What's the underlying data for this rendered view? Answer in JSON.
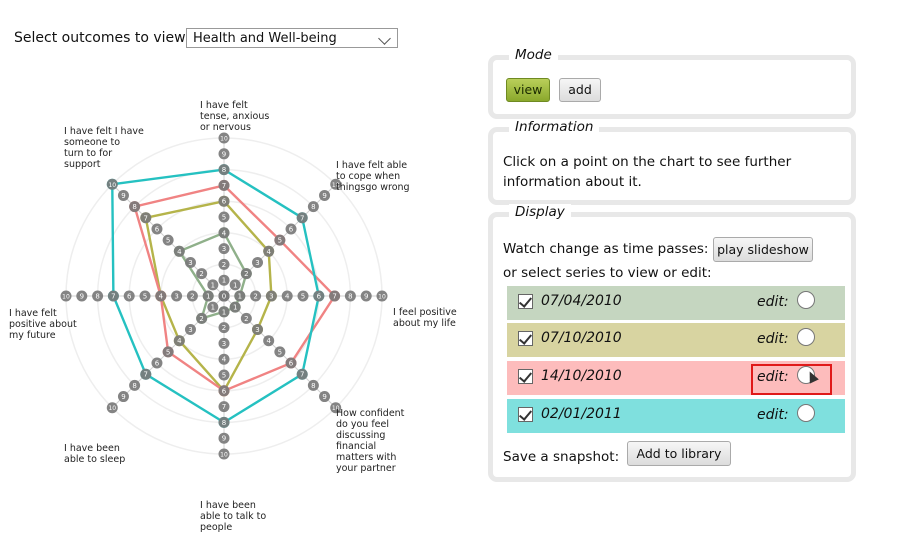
{
  "outcome_select": {
    "label": "Select outcomes to view:",
    "value": "Health and Well-being"
  },
  "chart_data": {
    "type": "radar",
    "axes": [
      "I have felt tense, anxious or nervous",
      "I have felt able to cope when things go wrong",
      "I feel positive about my life",
      "How confident do you feel discussing financial matters with your partner",
      "I have been able to talk to people",
      "I have been able to sleep",
      "I have felt positive about my future",
      "I have felt I have someone to turn to for support"
    ],
    "axis_label_lines": [
      [
        "I have felt",
        "tense, anxious",
        "or nervous"
      ],
      [
        "I have felt able",
        "to cope when",
        "thingsgo wrong"
      ],
      [
        "I feel positive",
        "about my life"
      ],
      [
        "How confident",
        "do you feel",
        "discussing",
        "financial",
        "matters with",
        "your partner"
      ],
      [
        "I have been",
        "able to talk to",
        "people"
      ],
      [
        "I have been",
        "able to sleep"
      ],
      [
        "I have felt",
        "positive about",
        "my future"
      ],
      [
        "I have felt I have",
        "someone to",
        "turn to for",
        "support"
      ]
    ],
    "scale": [
      0,
      10
    ],
    "ticks": [
      0,
      1,
      2,
      3,
      4,
      5,
      6,
      7,
      8,
      9,
      10
    ],
    "series": [
      {
        "name": "07/04/2010",
        "color": "#8fb08a",
        "values": [
          4,
          2,
          1,
          1,
          1,
          2,
          1,
          4
        ]
      },
      {
        "name": "07/10/2010",
        "color": "#b5b44a",
        "values": [
          6,
          4,
          3,
          3,
          6,
          4,
          4,
          7
        ]
      },
      {
        "name": "14/10/2010",
        "color": "#f08383",
        "values": [
          7,
          5,
          7,
          6,
          6,
          5,
          4,
          8
        ]
      },
      {
        "name": "02/01/2011",
        "color": "#25c1c1",
        "values": [
          8,
          7,
          6,
          7,
          8,
          7,
          7,
          10
        ]
      }
    ]
  },
  "mode": {
    "legend": "Mode",
    "view_label": "view",
    "add_label": "add"
  },
  "information": {
    "legend": "Information",
    "text": "Click on a point on the chart to see further information about it."
  },
  "display": {
    "legend": "Display",
    "watch_text": "Watch change as time passes:",
    "slideshow_label": "play slideshow",
    "select_text": "or select series to view or edit:",
    "edit_label": "edit:",
    "series": [
      {
        "date": "07/04/2010",
        "color": "#c5d6c0"
      },
      {
        "date": "07/10/2010",
        "color": "#d8d4a1"
      },
      {
        "date": "14/10/2010",
        "color": "#fdbcbc"
      },
      {
        "date": "02/01/2011",
        "color": "#7fe0de"
      }
    ],
    "snapshot_text": "Save a snapshot:",
    "library_label": "Add to library"
  }
}
